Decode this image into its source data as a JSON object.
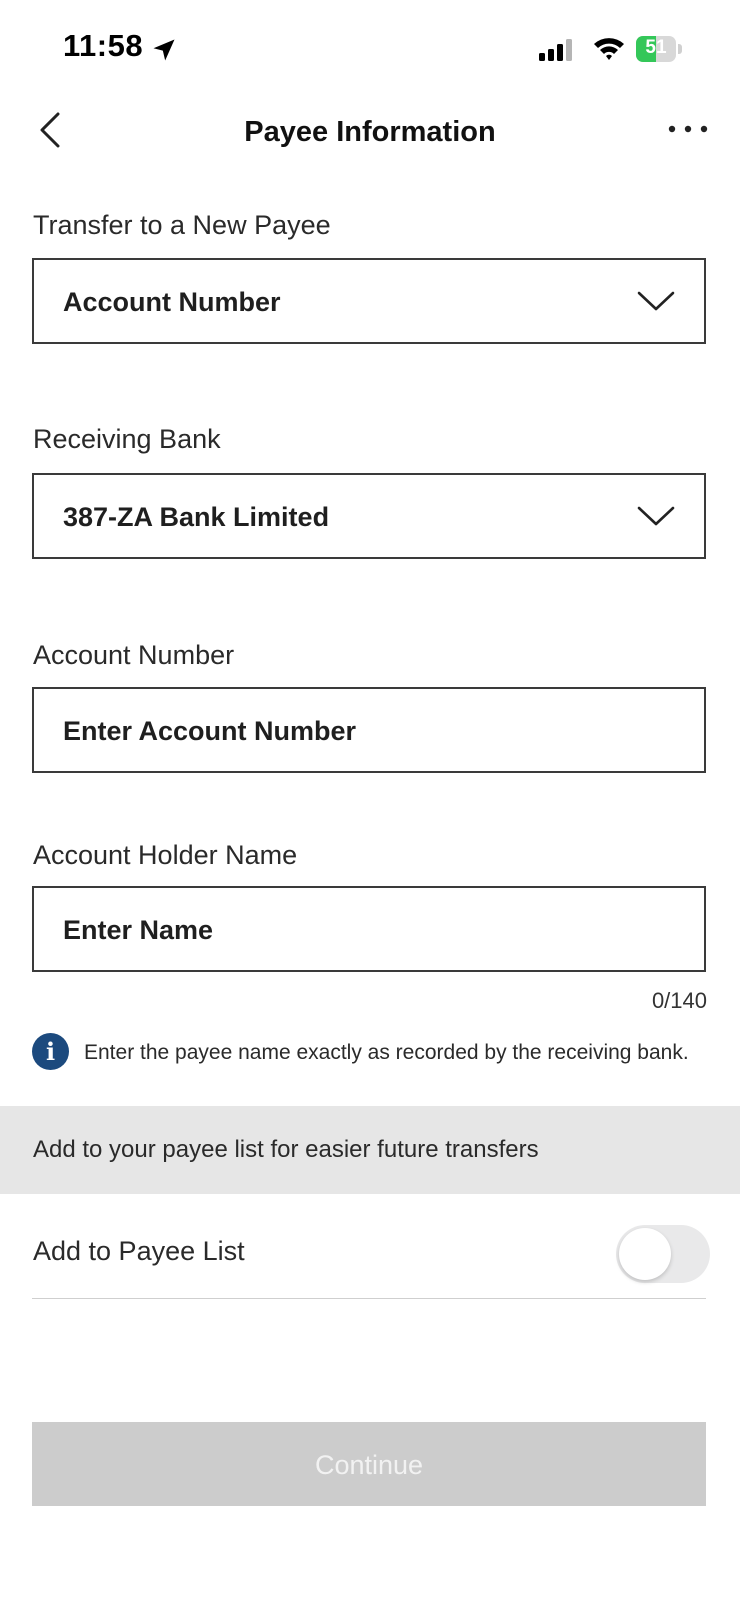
{
  "status_bar": {
    "time": "11:58",
    "battery": "51",
    "battery_level": 0.51,
    "icons": [
      "location-arrow-icon",
      "cellular-signal-icon",
      "wifi-icon",
      "battery-charging-icon"
    ]
  },
  "header": {
    "title": "Payee Information",
    "back_icon": "chevron-left-icon",
    "more_icon": "more-horizontal-icon"
  },
  "form": {
    "transfer_type": {
      "label": "Transfer to a New Payee",
      "value": "Account Number"
    },
    "receiving_bank": {
      "label": "Receiving Bank",
      "value": "387-ZA Bank Limited"
    },
    "account_number": {
      "label": "Account Number",
      "placeholder": "Enter Account Number"
    },
    "holder_name": {
      "label": "Account Holder Name",
      "placeholder": "Enter Name",
      "counter": "0/140"
    },
    "info_text": "Enter the payee name exactly as recorded by the receiving bank."
  },
  "payee_section": {
    "banner": "Add to your payee list for easier future transfers",
    "toggle_label": "Add to Payee List",
    "toggle_on": false
  },
  "footer": {
    "continue_label": "Continue"
  },
  "colors": {
    "info_icon": "#1c4a7e",
    "disabled_button": "#cccccc",
    "section_band": "#e6e6e6",
    "battery_green": "#34c759"
  }
}
